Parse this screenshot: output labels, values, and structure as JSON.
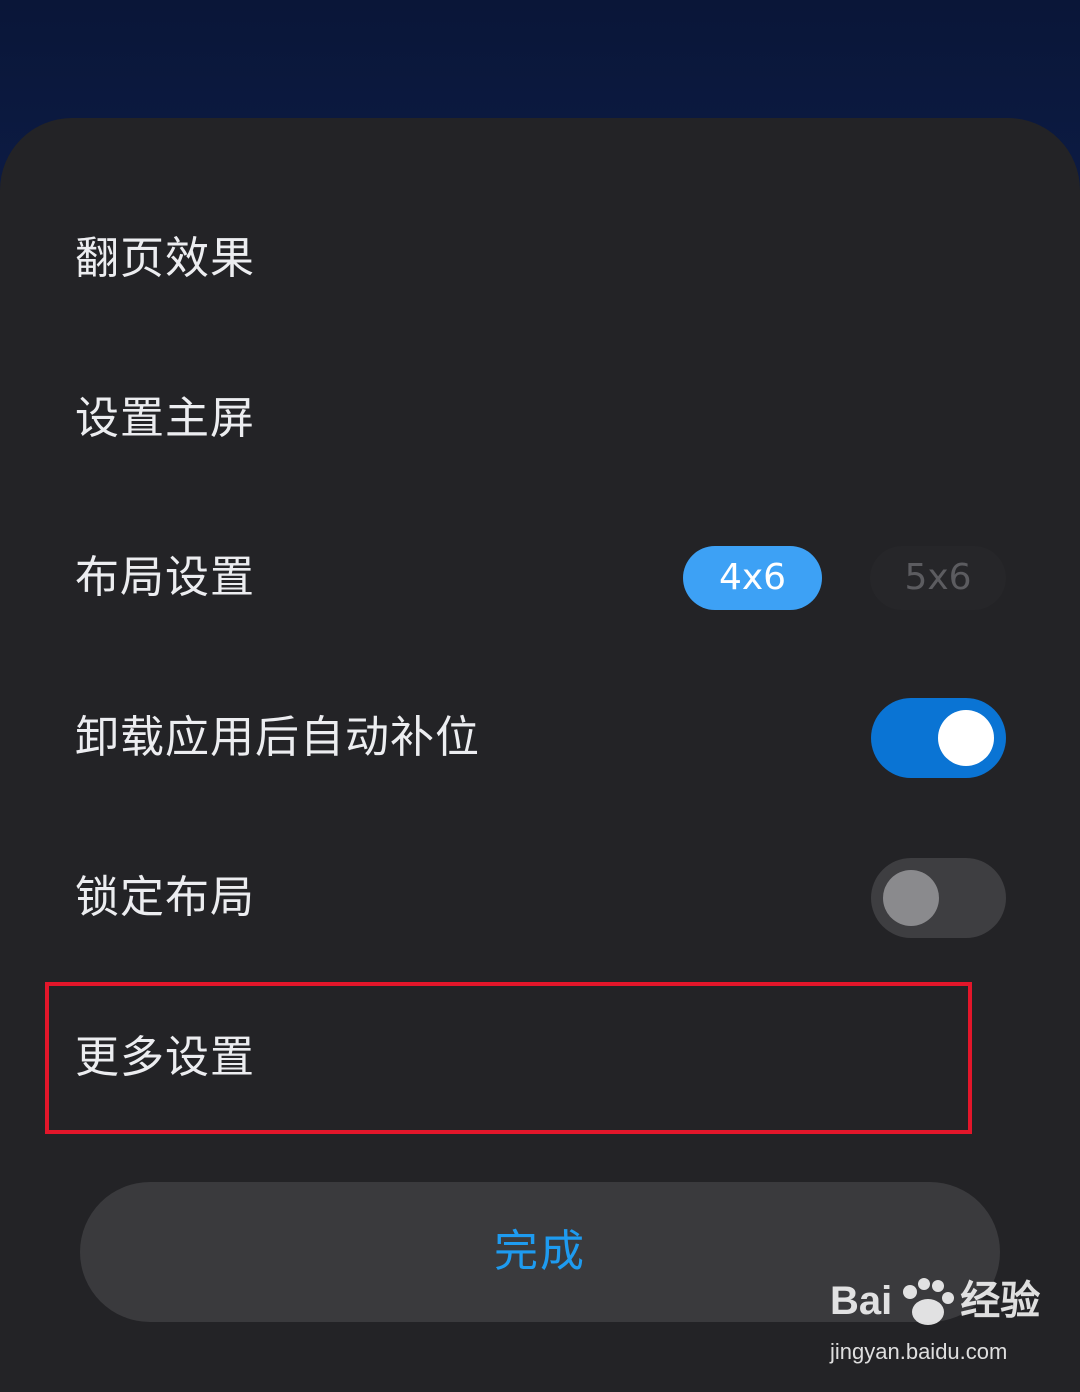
{
  "sheet": {
    "items": [
      {
        "label": "翻页效果"
      },
      {
        "label": "设置主屏"
      },
      {
        "label": "布局设置",
        "options": [
          "4x6",
          "5x6"
        ],
        "selected": "4x6"
      },
      {
        "label": "卸载应用后自动补位",
        "toggle": true
      },
      {
        "label": "锁定布局",
        "toggle": false
      },
      {
        "label": "更多设置"
      }
    ],
    "done_label": "完成"
  },
  "watermark": {
    "brand": "Bai",
    "brand_suffix": "经验",
    "url": "jingyan.baidu.com"
  },
  "colors": {
    "sheet_bg": "#232326",
    "accent": "#3da1f5",
    "toggle_on": "#0a74d4",
    "done_text": "#1e9bf0",
    "highlight": "#e2162a"
  }
}
